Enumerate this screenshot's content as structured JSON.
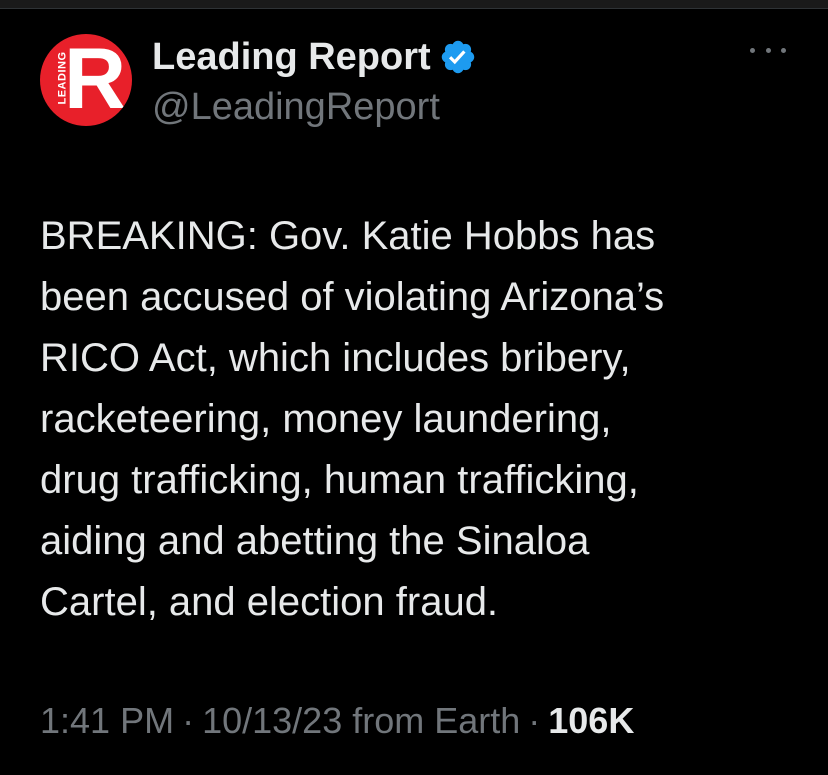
{
  "tweet": {
    "author": {
      "display_name": "Leading Report",
      "handle": "@LeadingReport",
      "verified": true,
      "avatar": {
        "letter": "R",
        "side_text": "LEADING",
        "color": "#e8202a"
      }
    },
    "more_icon": "more-horizontal-icon",
    "body_lines": [
      "BREAKING: Gov. Katie Hobbs has",
      "been accused of violating Arizona’s",
      "RICO Act, which includes bribery,",
      "racketeering, money laundering,",
      "drug trafficking, human trafficking,",
      "aiding and abetting the Sinaloa",
      "Cartel, and election fraud."
    ],
    "meta": {
      "time": "1:41 PM",
      "sep1": "·",
      "date": "10/13/23",
      "source": "from Earth",
      "sep2": "·",
      "views": "106K"
    }
  },
  "colors": {
    "background": "#000000",
    "text_primary": "#e7e9ea",
    "text_secondary": "#71767b",
    "verified_blue": "#1d9bf0"
  }
}
